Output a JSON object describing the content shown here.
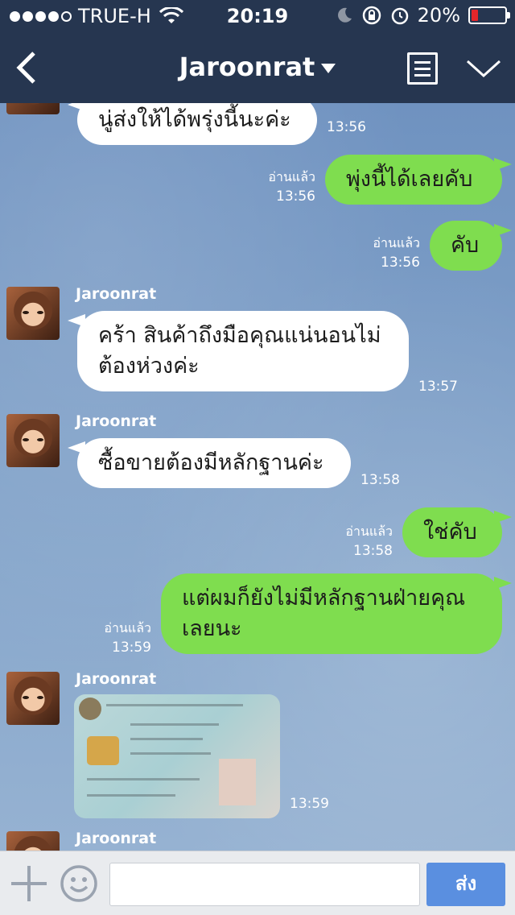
{
  "status_bar": {
    "carrier": "TRUE-H",
    "time": "20:19",
    "battery_percent": "20%",
    "battery_level": 0.2,
    "icons": [
      "signal-dots-icon",
      "wifi-icon",
      "moon-icon",
      "rotation-lock-icon",
      "alarm-icon",
      "battery-icon"
    ]
  },
  "nav": {
    "title": "Jaroonrat",
    "icons": [
      "back-chevron-icon",
      "dropdown-caret-icon",
      "menu-list-icon",
      "chevron-down-icon"
    ]
  },
  "messages": [
    {
      "dir": "in",
      "text": "นู่ส่งให้ได้พรุ่งนี้นะค่ะ",
      "time": "13:56"
    },
    {
      "dir": "out",
      "text": "พุ่งนี้ได้เลยคับ",
      "read": "อ่านแล้ว",
      "time": "13:56"
    },
    {
      "dir": "out",
      "text": "คับ",
      "read": "อ่านแล้ว",
      "time": "13:56"
    },
    {
      "dir": "in",
      "sender": "Jaroonrat",
      "line1": "คร้า สินค้าถึงมือคุณแน่นอนไม่",
      "line2": "ต้องห่วงค่ะ",
      "time": "13:57"
    },
    {
      "dir": "in",
      "sender": "Jaroonrat",
      "text": "ซื้อขายต้องมีหลักฐานค่ะ",
      "time": "13:58"
    },
    {
      "dir": "out",
      "text": "ใช่คับ",
      "read": "อ่านแล้ว",
      "time": "13:58"
    },
    {
      "dir": "out",
      "line1": "แต่ผมก็ยังไม่มีหลักฐานฝ่ายคุณ",
      "line2": "เลยนะ",
      "read": "อ่านแล้ว",
      "time": "13:59"
    },
    {
      "dir": "in",
      "sender": "Jaroonrat",
      "image": "photo-of-id-card",
      "time": "13:59"
    },
    {
      "dir": "in",
      "sender": "Jaroonrat"
    }
  ],
  "input_bar": {
    "placeholder": "",
    "send_label": "ส่ง",
    "colors": {
      "send": "#5a8fe0",
      "outgoing": "#7fdd4f",
      "incoming": "#ffffff",
      "header": "#263650"
    }
  }
}
